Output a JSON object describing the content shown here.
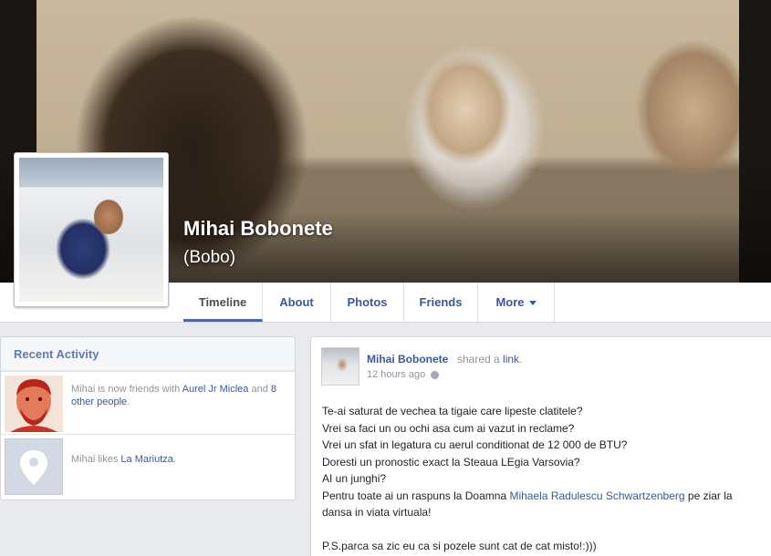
{
  "profile": {
    "name": "Mihai Bobonete",
    "nickname": "(Bobo)"
  },
  "tabs": [
    {
      "label": "Timeline",
      "active": true
    },
    {
      "label": "About"
    },
    {
      "label": "Photos"
    },
    {
      "label": "Friends"
    },
    {
      "label": "More"
    }
  ],
  "recent_activity": {
    "title": "Recent Activity",
    "items": [
      {
        "subject": "Mihai",
        "verb": " is now friends with ",
        "link1": "Aurel Jr Miclea",
        "mid": " and ",
        "link2": "8 other people",
        "end": "."
      },
      {
        "subject": "Mihai",
        "verb": " likes ",
        "link1": "La Mariutza",
        "end": "."
      }
    ]
  },
  "post": {
    "author": "Mihai Bobonete",
    "action": "shared a ",
    "action_link": "link",
    "action_end": ".",
    "time": "12 hours ago",
    "lines": [
      "Te-ai saturat de vechea ta tigaie care lipeste clatitele?",
      "Vrei sa faci un ou ochi asa cum ai vazut in reclame?",
      "Vrei un sfat in legatura cu aerul conditionat de 12 000 de BTU?",
      "Doresti un pronostic exact la Steaua LEgia Varsovia?",
      "AI un junghi?"
    ],
    "line6_pre": "Pentru toate ai un raspuns la Doamna ",
    "line6_link": "Mihaela Radulescu Schwartzenberg",
    "line6_post": " pe ziar la",
    "line7": "dansa in viata virtuala!",
    "ps": "P.S.parca sa zic eu ca si pozele sunt cat de cat misto!:)))"
  },
  "colors": {
    "link": "#3b5998",
    "muted": "#90949c",
    "background": "#e9eaed"
  }
}
